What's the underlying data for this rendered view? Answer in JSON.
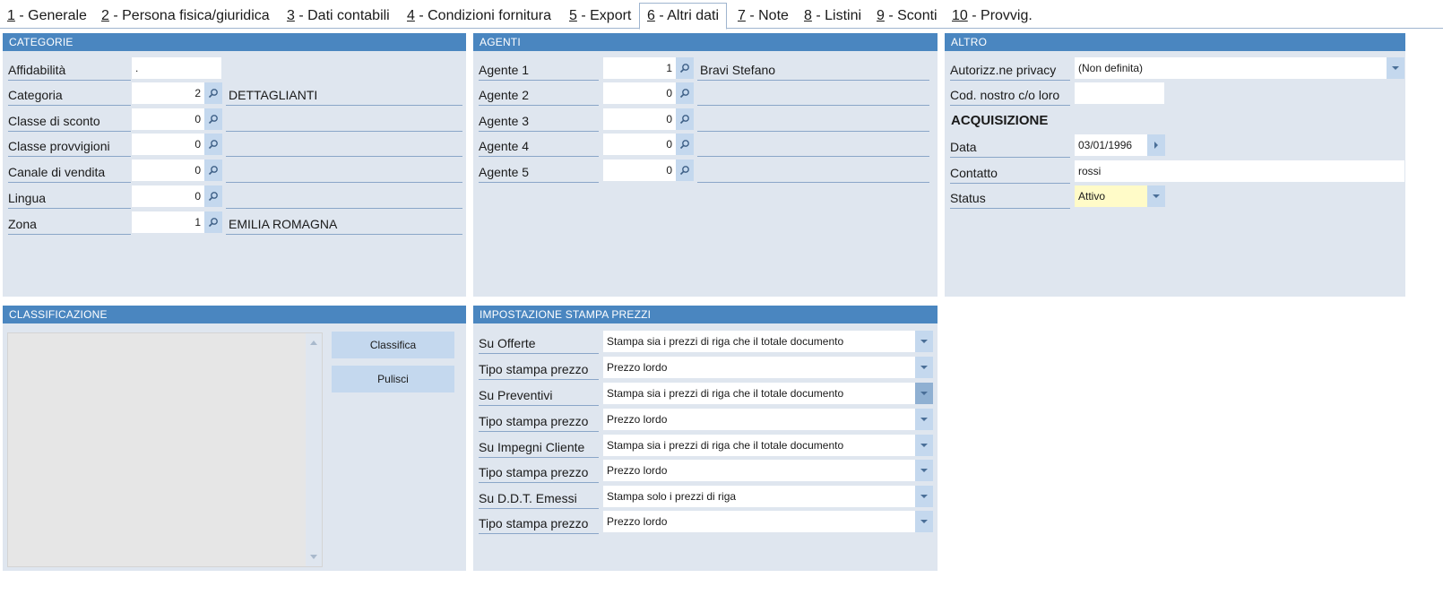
{
  "tabs": [
    {
      "key": "1",
      "label": " - Generale"
    },
    {
      "key": "2",
      "label": " - Persona fisica/giuridica"
    },
    {
      "key": "3",
      "label": " - Dati contabili"
    },
    {
      "key": "4",
      "label": " - Condizioni fornitura"
    },
    {
      "key": "5",
      "label": " - Export"
    },
    {
      "key": "6",
      "label": " - Altri dati"
    },
    {
      "key": "7",
      "label": " - Note"
    },
    {
      "key": "8",
      "label": " - Listini"
    },
    {
      "key": "9",
      "label": " - Sconti"
    },
    {
      "key": "10",
      "label": " - Provvig."
    }
  ],
  "active_tab": "6",
  "categorie": {
    "title": "CATEGORIE",
    "affidabilita": {
      "label": "Affidabilità",
      "value": "."
    },
    "rows": [
      {
        "label": "Categoria",
        "value": "2",
        "desc": "DETTAGLIANTI"
      },
      {
        "label": "Classe di sconto",
        "value": "0",
        "desc": ""
      },
      {
        "label": "Classe provvigioni",
        "value": "0",
        "desc": ""
      },
      {
        "label": "Canale di vendita",
        "value": "0",
        "desc": ""
      },
      {
        "label": "Lingua",
        "value": "0",
        "desc": ""
      },
      {
        "label": "Zona",
        "value": "1",
        "desc": "EMILIA ROMAGNA"
      }
    ]
  },
  "agenti": {
    "title": "AGENTI",
    "rows": [
      {
        "label": "Agente 1",
        "value": "1",
        "desc": "Bravi Stefano"
      },
      {
        "label": "Agente 2",
        "value": "0",
        "desc": ""
      },
      {
        "label": "Agente 3",
        "value": "0",
        "desc": ""
      },
      {
        "label": "Agente 4",
        "value": "0",
        "desc": ""
      },
      {
        "label": "Agente 5",
        "value": "0",
        "desc": ""
      }
    ]
  },
  "altro": {
    "title": "ALTRO",
    "privacy": {
      "label": "Autorizz.ne privacy",
      "value": "(Non definita)"
    },
    "cod_nostro": {
      "label": "Cod. nostro c/o loro",
      "value": ""
    },
    "acquisizione_title": "ACQUISIZIONE",
    "data": {
      "label": "Data",
      "value": "03/01/1996"
    },
    "contatto": {
      "label": "Contatto",
      "value": "rossi"
    },
    "status": {
      "label": "Status",
      "value": "Attivo",
      "color": "#fffbc8"
    }
  },
  "classificazione": {
    "title": "CLASSIFICAZIONE",
    "classifica_label": "Classifica",
    "pulisci_label": "Pulisci"
  },
  "stampa_prezzi": {
    "title": "IMPOSTAZIONE STAMPA PREZZI",
    "rows": [
      {
        "label": "Su Offerte",
        "value": "Stampa sia i prezzi di riga che il totale documento"
      },
      {
        "label": "Tipo stampa prezzo",
        "value": "Prezzo lordo"
      },
      {
        "label": "Su Preventivi",
        "value": "Stampa sia i prezzi di riga che il totale documento"
      },
      {
        "label": "Tipo stampa prezzo",
        "value": "Prezzo lordo"
      },
      {
        "label": "Su Impegni Cliente",
        "value": "Stampa sia i prezzi di riga che il totale documento"
      },
      {
        "label": "Tipo stampa prezzo",
        "value": "Prezzo lordo"
      },
      {
        "label": "Su D.D.T. Emessi",
        "value": "Stampa solo i prezzi di riga"
      },
      {
        "label": "Tipo stampa prezzo",
        "value": "Prezzo lordo"
      }
    ]
  },
  "colors": {
    "header": "#4a86c0",
    "panel": "#dfe6ef",
    "button": "#c4d8ee"
  }
}
